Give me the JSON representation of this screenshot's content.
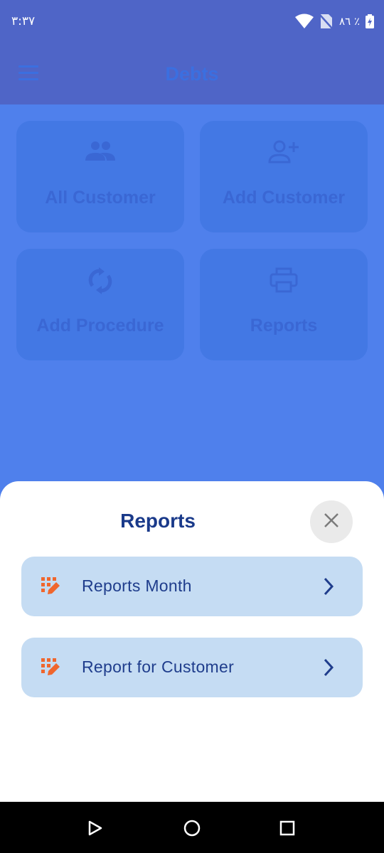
{
  "status_bar": {
    "time": "٣:٣٧",
    "battery_text": "٨٦ ٪",
    "icons": [
      "wifi-icon",
      "no-sim-icon",
      "battery-icon"
    ]
  },
  "app_bar": {
    "title": "Debts",
    "menu_icon": "menu-icon"
  },
  "dashboard": {
    "cards": [
      {
        "label": "All Customer",
        "icon": "people-icon"
      },
      {
        "label": "Add Customer",
        "icon": "person-add-icon"
      },
      {
        "label": "Add Procedure",
        "icon": "sync-icon"
      },
      {
        "label": "Reports",
        "icon": "printer-icon"
      }
    ]
  },
  "sheet": {
    "title": "Reports",
    "close_icon": "close-icon",
    "items": [
      {
        "label": "Reports Month",
        "icon": "report-edit-icon"
      },
      {
        "label": "Report for Customer",
        "icon": "report-edit-icon"
      }
    ]
  },
  "nav_bar": {
    "icons": [
      "back-icon",
      "home-icon",
      "recents-icon"
    ]
  },
  "colors": {
    "background": "#4f80ec",
    "app_bar": "#4f65c7",
    "card": "#4378e4",
    "sheet_item": "#c5dcf3",
    "accent_text": "#1a3a8a",
    "icon_orange": "#f0662d"
  }
}
